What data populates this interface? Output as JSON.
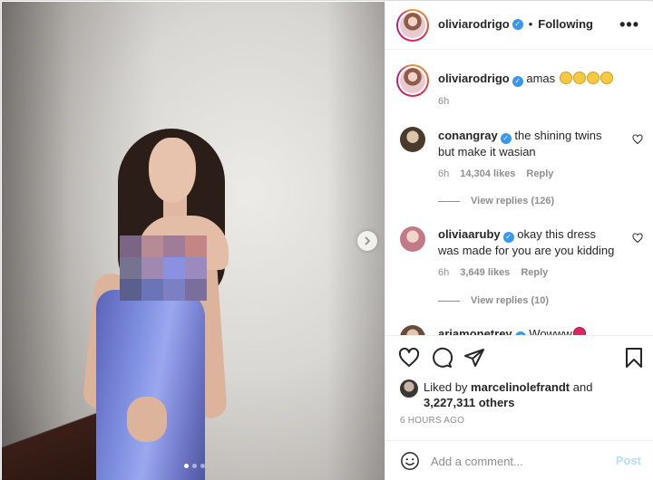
{
  "post": {
    "author": "oliviarodrigo",
    "follow_status": "Following",
    "separator": "•",
    "more_glyph": "•••",
    "caption_text": "amas",
    "caption_time": "6h"
  },
  "comments": [
    {
      "username": "conangray",
      "text": "the shining twins but make it wasian",
      "time": "6h",
      "likes": "14,304 likes",
      "reply": "Reply",
      "view_replies": "View replies (126)"
    },
    {
      "username": "oliviaaruby",
      "text": "okay this dress was made for you are you kidding",
      "time": "6h",
      "likes": "3,649 likes",
      "reply": "Reply",
      "view_replies": "View replies (10)"
    },
    {
      "username": "ariamonetrey",
      "text": "Wowww"
    }
  ],
  "liked_by": {
    "prefix": "Liked by",
    "user": "marcelinolefrandt",
    "and": "and",
    "others": "3,227,311 others"
  },
  "timestamp": "6 HOURS AGO",
  "add_comment": {
    "placeholder": "Add a comment...",
    "post_label": "Post"
  },
  "carousel": {
    "current": 1,
    "total": 3
  },
  "colors": {
    "verified": "#3897f0",
    "post_disabled": "#b2dffc",
    "muted": "#8e8e8e"
  },
  "mosaic_colors": [
    "#7a6585",
    "#b68b96",
    "#a07c99",
    "#c48585",
    "#75738f",
    "#a188b0",
    "#8a92e0",
    "#9a8ac0",
    "#5a5f8c",
    "#6c74b8",
    "#7d7fc3",
    "#7a6f9c"
  ]
}
